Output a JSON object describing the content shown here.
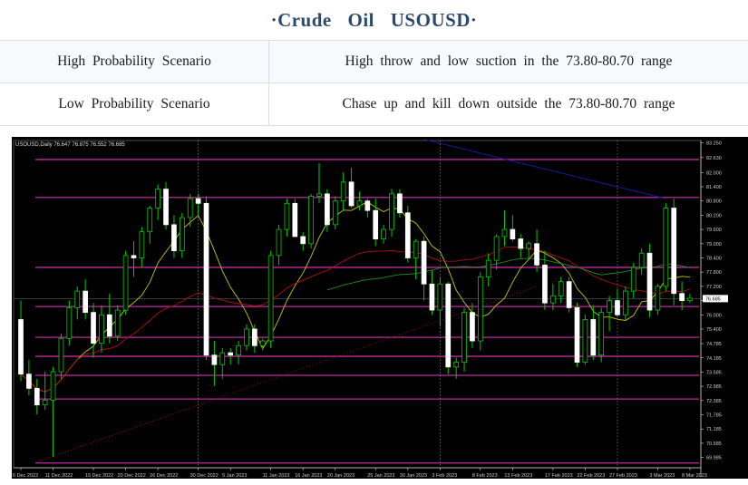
{
  "header": {
    "title": "·Crude Oil USOUSD·"
  },
  "scenarios": [
    {
      "label": "High Probability Scenario",
      "description": "High throw and low suction in the 73.80-80.70 range"
    },
    {
      "label": "Low Probability Scenario",
      "description": "Chase up and kill down outside the 73.80-80.70 range"
    }
  ],
  "chart_data": {
    "type": "candlestick",
    "symbol_label": "USOUSD,Daily 76.647 76.875 76.552 76.685",
    "ylim": [
      69.55,
      83.35
    ],
    "y_ticks": [
      "83.250",
      "82.630",
      "82.000",
      "81.400",
      "80.800",
      "80.200",
      "79.600",
      "79.000",
      "78.400",
      "77.800",
      "77.200",
      "76.600",
      "76.000",
      "75.400",
      "74.785",
      "74.185",
      "73.585",
      "72.985",
      "72.385",
      "71.785",
      "71.185",
      "70.585",
      "69.985"
    ],
    "x_ticks": [
      "6 Dec 2022",
      "11 Dec 2022",
      "15 Dec 2022",
      "20 Dec 2022",
      "26 Dec 2022",
      "30 Dec 2022",
      "5 Jan 2023",
      "11 Jan 2023",
      "16 Jan 2023",
      "20 Jan 2023",
      "25 Jan 2023",
      "30 Jan 2023",
      "3 Feb 2023",
      "8 Feb 2023",
      "13 Feb 2023",
      "17 Feb 2023",
      "22 Feb 2023",
      "27 Feb 2023",
      "3 Mar 2023",
      "8 Mar 2023"
    ],
    "horizontal_levels": [
      82.55,
      80.95,
      78.0,
      76.35,
      75.05,
      74.25,
      73.45,
      72.45,
      69.75
    ],
    "current_price": 76.685,
    "colors": {
      "background": "#000000",
      "levels": "#c02aa0",
      "bull": "#ffffff",
      "bear": "#ffffff",
      "wick": "#00cc00",
      "ma_fast": "#c8c800",
      "ma_mid": "#b01010",
      "ma_slow": "#228b22",
      "ma_long": "#1a1aa0"
    },
    "candles": [
      {
        "o": 75.8,
        "h": 76.6,
        "l": 73.2,
        "c": 73.5
      },
      {
        "o": 73.5,
        "h": 74.1,
        "l": 72.6,
        "c": 72.9
      },
      {
        "o": 72.9,
        "h": 73.3,
        "l": 71.8,
        "c": 72.2
      },
      {
        "o": 72.2,
        "h": 73.6,
        "l": 72.0,
        "c": 72.4
      },
      {
        "o": 72.4,
        "h": 73.8,
        "l": 70.0,
        "c": 73.6
      },
      {
        "o": 73.6,
        "h": 75.2,
        "l": 73.3,
        "c": 75.0
      },
      {
        "o": 75.0,
        "h": 76.6,
        "l": 74.7,
        "c": 76.3
      },
      {
        "o": 76.3,
        "h": 77.2,
        "l": 75.8,
        "c": 77.0
      },
      {
        "o": 77.0,
        "h": 77.5,
        "l": 75.8,
        "c": 76.1
      },
      {
        "o": 76.1,
        "h": 76.5,
        "l": 74.2,
        "c": 74.8
      },
      {
        "o": 74.8,
        "h": 76.4,
        "l": 74.4,
        "c": 76.0
      },
      {
        "o": 76.0,
        "h": 76.9,
        "l": 74.8,
        "c": 75.1
      },
      {
        "o": 75.1,
        "h": 76.4,
        "l": 74.9,
        "c": 76.2
      },
      {
        "o": 76.2,
        "h": 78.7,
        "l": 76.0,
        "c": 78.5
      },
      {
        "o": 78.5,
        "h": 79.1,
        "l": 77.6,
        "c": 78.4
      },
      {
        "o": 78.4,
        "h": 79.7,
        "l": 78.0,
        "c": 79.5
      },
      {
        "o": 79.5,
        "h": 80.6,
        "l": 79.0,
        "c": 80.5
      },
      {
        "o": 80.5,
        "h": 81.5,
        "l": 80.0,
        "c": 81.3
      },
      {
        "o": 81.3,
        "h": 81.6,
        "l": 79.6,
        "c": 79.8
      },
      {
        "o": 79.8,
        "h": 80.2,
        "l": 78.4,
        "c": 78.7
      },
      {
        "o": 78.7,
        "h": 80.3,
        "l": 78.4,
        "c": 80.1
      },
      {
        "o": 80.1,
        "h": 81.1,
        "l": 79.7,
        "c": 80.9
      },
      {
        "o": 80.9,
        "h": 81.1,
        "l": 80.2,
        "c": 80.7
      },
      {
        "o": 80.7,
        "h": 81.0,
        "l": 74.1,
        "c": 74.3
      },
      {
        "o": 74.3,
        "h": 74.9,
        "l": 73.0,
        "c": 73.9
      },
      {
        "o": 73.9,
        "h": 74.6,
        "l": 73.3,
        "c": 74.4
      },
      {
        "o": 74.4,
        "h": 74.6,
        "l": 73.9,
        "c": 74.3
      },
      {
        "o": 74.3,
        "h": 74.9,
        "l": 73.9,
        "c": 74.7
      },
      {
        "o": 74.7,
        "h": 75.6,
        "l": 74.5,
        "c": 75.4
      },
      {
        "o": 75.4,
        "h": 75.6,
        "l": 74.4,
        "c": 74.7
      },
      {
        "o": 74.7,
        "h": 75.0,
        "l": 74.5,
        "c": 74.9
      },
      {
        "o": 74.9,
        "h": 78.7,
        "l": 74.6,
        "c": 78.5
      },
      {
        "o": 78.5,
        "h": 79.8,
        "l": 78.1,
        "c": 79.6
      },
      {
        "o": 79.6,
        "h": 80.9,
        "l": 79.3,
        "c": 80.7
      },
      {
        "o": 80.7,
        "h": 80.9,
        "l": 79.3,
        "c": 79.3
      },
      {
        "o": 79.3,
        "h": 79.5,
        "l": 78.7,
        "c": 79.0
      },
      {
        "o": 79.0,
        "h": 81.1,
        "l": 78.8,
        "c": 81.0
      },
      {
        "o": 81.0,
        "h": 82.4,
        "l": 80.7,
        "c": 81.1
      },
      {
        "o": 81.1,
        "h": 81.3,
        "l": 79.5,
        "c": 79.8
      },
      {
        "o": 79.8,
        "h": 81.0,
        "l": 79.6,
        "c": 80.8
      },
      {
        "o": 80.8,
        "h": 82.0,
        "l": 80.4,
        "c": 81.6
      },
      {
        "o": 81.6,
        "h": 82.2,
        "l": 80.5,
        "c": 80.6
      },
      {
        "o": 80.6,
        "h": 81.2,
        "l": 80.4,
        "c": 80.8
      },
      {
        "o": 80.8,
        "h": 80.9,
        "l": 80.1,
        "c": 80.4
      },
      {
        "o": 80.4,
        "h": 80.9,
        "l": 78.9,
        "c": 79.2
      },
      {
        "o": 79.2,
        "h": 79.8,
        "l": 79.0,
        "c": 79.6
      },
      {
        "o": 79.6,
        "h": 81.3,
        "l": 79.3,
        "c": 81.1
      },
      {
        "o": 81.1,
        "h": 81.3,
        "l": 80.1,
        "c": 80.3
      },
      {
        "o": 80.3,
        "h": 80.6,
        "l": 78.2,
        "c": 78.4
      },
      {
        "o": 78.4,
        "h": 79.2,
        "l": 77.5,
        "c": 79.1
      },
      {
        "o": 79.1,
        "h": 79.3,
        "l": 76.6,
        "c": 77.3
      },
      {
        "o": 77.3,
        "h": 77.9,
        "l": 76.0,
        "c": 76.2
      },
      {
        "o": 76.2,
        "h": 77.6,
        "l": 75.5,
        "c": 77.3
      },
      {
        "o": 77.3,
        "h": 77.4,
        "l": 73.5,
        "c": 73.8
      },
      {
        "o": 73.8,
        "h": 74.2,
        "l": 73.3,
        "c": 74.0
      },
      {
        "o": 74.0,
        "h": 76.3,
        "l": 73.6,
        "c": 76.1
      },
      {
        "o": 76.1,
        "h": 76.5,
        "l": 74.6,
        "c": 74.9
      },
      {
        "o": 74.9,
        "h": 77.8,
        "l": 74.5,
        "c": 77.6
      },
      {
        "o": 77.6,
        "h": 78.6,
        "l": 77.2,
        "c": 78.3
      },
      {
        "o": 78.3,
        "h": 79.4,
        "l": 77.9,
        "c": 79.3
      },
      {
        "o": 79.3,
        "h": 80.4,
        "l": 78.9,
        "c": 79.6
      },
      {
        "o": 79.6,
        "h": 80.2,
        "l": 79.1,
        "c": 79.2
      },
      {
        "o": 79.2,
        "h": 79.4,
        "l": 78.4,
        "c": 78.8
      },
      {
        "o": 78.8,
        "h": 79.1,
        "l": 78.3,
        "c": 79.0
      },
      {
        "o": 79.0,
        "h": 79.6,
        "l": 77.8,
        "c": 78.1
      },
      {
        "o": 78.1,
        "h": 78.7,
        "l": 76.2,
        "c": 76.5
      },
      {
        "o": 76.5,
        "h": 77.3,
        "l": 76.2,
        "c": 76.8
      },
      {
        "o": 76.8,
        "h": 77.6,
        "l": 76.5,
        "c": 77.4
      },
      {
        "o": 77.4,
        "h": 77.6,
        "l": 76.1,
        "c": 76.3
      },
      {
        "o": 76.3,
        "h": 76.5,
        "l": 73.8,
        "c": 74.0
      },
      {
        "o": 74.0,
        "h": 76.0,
        "l": 73.9,
        "c": 75.8
      },
      {
        "o": 75.8,
        "h": 76.4,
        "l": 74.1,
        "c": 74.3
      },
      {
        "o": 74.3,
        "h": 76.3,
        "l": 74.0,
        "c": 76.1
      },
      {
        "o": 76.1,
        "h": 76.8,
        "l": 75.3,
        "c": 76.6
      },
      {
        "o": 76.6,
        "h": 77.1,
        "l": 75.9,
        "c": 76.0
      },
      {
        "o": 76.0,
        "h": 77.2,
        "l": 75.8,
        "c": 77.0
      },
      {
        "o": 77.0,
        "h": 78.2,
        "l": 76.7,
        "c": 78.0
      },
      {
        "o": 78.0,
        "h": 78.8,
        "l": 77.7,
        "c": 78.6
      },
      {
        "o": 78.6,
        "h": 79.0,
        "l": 75.9,
        "c": 76.2
      },
      {
        "o": 76.2,
        "h": 77.3,
        "l": 76.0,
        "c": 77.2
      },
      {
        "o": 77.2,
        "h": 80.7,
        "l": 77.0,
        "c": 80.5
      },
      {
        "o": 80.5,
        "h": 80.9,
        "l": 76.4,
        "c": 76.9
      },
      {
        "o": 76.9,
        "h": 77.4,
        "l": 76.2,
        "c": 76.6
      },
      {
        "o": 76.6,
        "h": 76.9,
        "l": 76.5,
        "c": 76.7
      }
    ]
  }
}
